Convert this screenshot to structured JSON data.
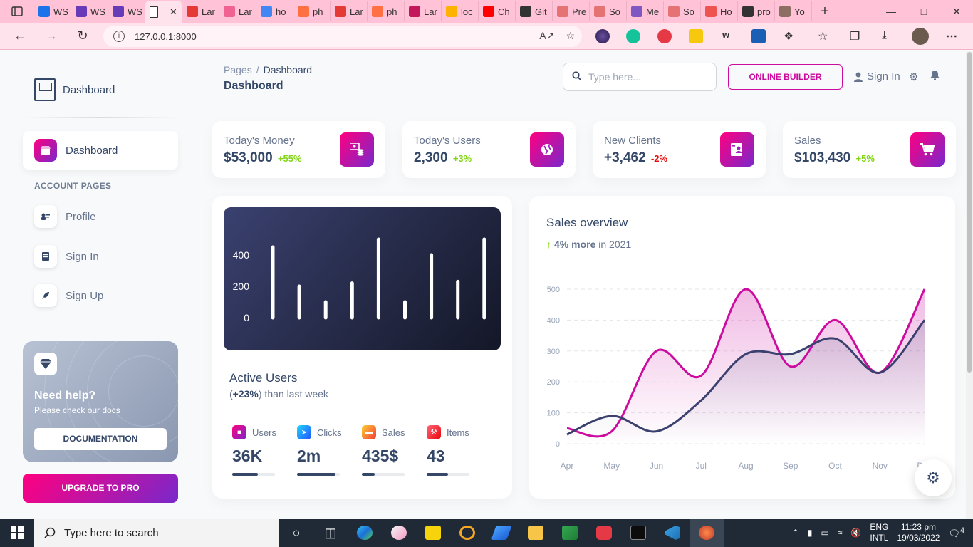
{
  "browser": {
    "tabs": [
      {
        "label": "WS",
        "color": "#1a73e8"
      },
      {
        "label": "WS",
        "color": "#673ab7"
      },
      {
        "label": "WS",
        "color": "#673ab7"
      },
      {
        "label": "",
        "color": "#ffffff",
        "active": true
      },
      {
        "label": "Lar",
        "color": "#e53935"
      },
      {
        "label": "Lar",
        "color": "#f06292"
      },
      {
        "label": "ho",
        "color": "#4285f4"
      },
      {
        "label": "ph",
        "color": "#ff7043"
      },
      {
        "label": "Lar",
        "color": "#e53935"
      },
      {
        "label": "ph",
        "color": "#ff7043"
      },
      {
        "label": "Lar",
        "color": "#c2185b"
      },
      {
        "label": "loc",
        "color": "#ffb300"
      },
      {
        "label": "Ch",
        "color": "#ff0000"
      },
      {
        "label": "Git",
        "color": "#333333"
      },
      {
        "label": "Pre",
        "color": "#e57373"
      },
      {
        "label": "So",
        "color": "#e57373"
      },
      {
        "label": "Me",
        "color": "#7e57c2"
      },
      {
        "label": "So",
        "color": "#e57373"
      },
      {
        "label": "Ho",
        "color": "#ef5350"
      },
      {
        "label": "pro",
        "color": "#333333"
      },
      {
        "label": "Yo",
        "color": "#8d6e63"
      }
    ],
    "url": "127.0.0.1:8000"
  },
  "sidebar": {
    "brand": "Dashboard",
    "active_item": "Dashboard",
    "section_title": "ACCOUNT PAGES",
    "items": [
      {
        "label": "Profile",
        "icon": "profile-icon"
      },
      {
        "label": "Sign In",
        "icon": "document-icon"
      },
      {
        "label": "Sign Up",
        "icon": "rocket-icon"
      }
    ],
    "help": {
      "title": "Need help?",
      "subtitle": "Please check our docs",
      "button": "DOCUMENTATION"
    },
    "upgrade_button": "UPGRADE TO PRO"
  },
  "navbar": {
    "breadcrumb_root": "Pages",
    "breadcrumb_separator": "/",
    "breadcrumb_current": "Dashboard",
    "title": "Dashboard",
    "search_placeholder": "Type here...",
    "online_builder": "ONLINE BUILDER",
    "sign_in": "Sign In"
  },
  "stats": [
    {
      "label": "Today's Money",
      "value": "$53,000",
      "change": "+55%",
      "positive": true,
      "icon": "money-icon"
    },
    {
      "label": "Today's Users",
      "value": "2,300",
      "change": "+3%",
      "positive": true,
      "icon": "globe-icon"
    },
    {
      "label": "New Clients",
      "value": "+3,462",
      "change": "-2%",
      "positive": false,
      "icon": "clients-icon"
    },
    {
      "label": "Sales",
      "value": "$103,430",
      "change": "+5%",
      "positive": true,
      "icon": "cart-icon"
    }
  ],
  "active_users": {
    "title": "Active Users",
    "subtitle_prefix": "(",
    "subtitle_bold": "+23%",
    "subtitle_suffix": ") than last week",
    "metrics": [
      {
        "label": "Users",
        "value": "36K",
        "progress": 0.6,
        "color": "#cb0c9f"
      },
      {
        "label": "Clicks",
        "value": "2m",
        "progress": 0.9,
        "color": "#17c1e8"
      },
      {
        "label": "Sales",
        "value": "435$",
        "progress": 0.3,
        "color": "#f5a623"
      },
      {
        "label": "Items",
        "value": "43",
        "progress": 0.5,
        "color": "#ea0606"
      }
    ]
  },
  "sales_overview": {
    "title": "Sales overview",
    "growth": "4% more",
    "period": "in 2021"
  },
  "chart_data": [
    {
      "type": "bar",
      "yticks": [
        0,
        200,
        400
      ],
      "ylim": [
        0,
        500
      ],
      "values": [
        450,
        200,
        100,
        220,
        500,
        100,
        400,
        230,
        500
      ]
    },
    {
      "type": "area",
      "categories": [
        "Apr",
        "May",
        "Jun",
        "Jul",
        "Aug",
        "Sep",
        "Oct",
        "Nov",
        "Dec"
      ],
      "yticks": [
        0,
        100,
        200,
        300,
        400,
        500
      ],
      "ylim": [
        0,
        500
      ],
      "grid": true,
      "series": [
        {
          "values": [
            50,
            40,
            300,
            220,
            500,
            250,
            400,
            230,
            500
          ],
          "color": "#cb0c9f"
        },
        {
          "values": [
            30,
            90,
            40,
            140,
            290,
            290,
            340,
            230,
            400
          ],
          "color": "#3a416f"
        }
      ]
    }
  ],
  "taskbar": {
    "search_placeholder": "Type here to search",
    "language": "ENG",
    "layout": "INTL",
    "time": "11:23 pm",
    "date": "19/03/2022",
    "notifications": "4"
  }
}
